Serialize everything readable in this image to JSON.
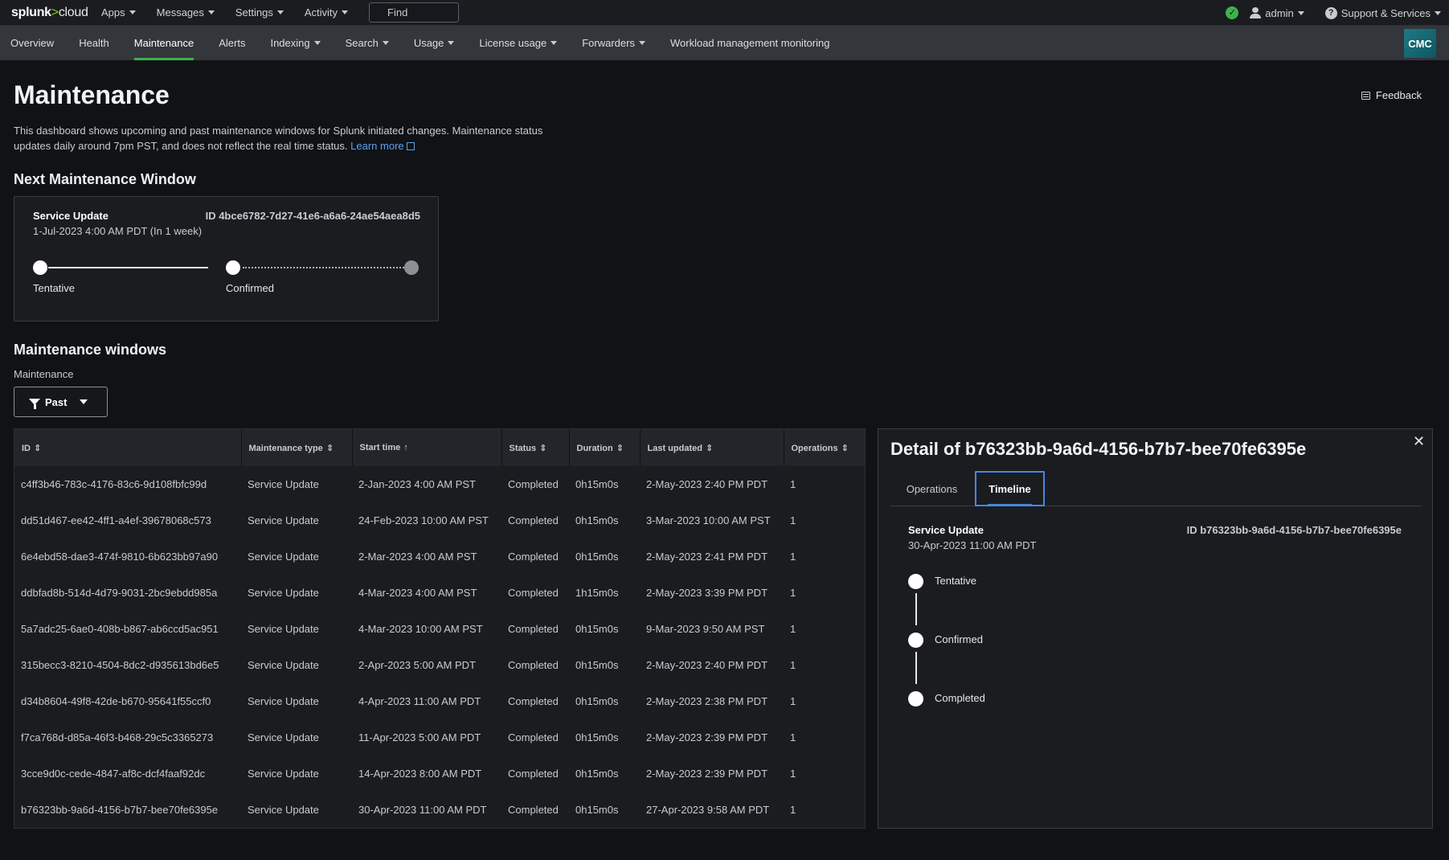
{
  "topbar": {
    "logo_main": "splunk",
    "logo_gt": ">",
    "logo_suffix": "cloud",
    "menu": [
      "Apps",
      "Messages",
      "Settings",
      "Activity"
    ],
    "find_label": "Find",
    "user": "admin",
    "support": "Support & Services"
  },
  "nav": {
    "tabs": [
      {
        "label": "Overview",
        "dropdown": false
      },
      {
        "label": "Health",
        "dropdown": false
      },
      {
        "label": "Maintenance",
        "dropdown": false,
        "active": true
      },
      {
        "label": "Alerts",
        "dropdown": false
      },
      {
        "label": "Indexing",
        "dropdown": true
      },
      {
        "label": "Search",
        "dropdown": true
      },
      {
        "label": "Usage",
        "dropdown": true
      },
      {
        "label": "License usage",
        "dropdown": true
      },
      {
        "label": "Forwarders",
        "dropdown": true
      },
      {
        "label": "Workload management monitoring",
        "dropdown": false
      }
    ],
    "app_badge": "CMC"
  },
  "page": {
    "title": "Maintenance",
    "feedback": "Feedback",
    "description": "This dashboard shows upcoming and past maintenance windows for Splunk initiated changes. Maintenance status updates daily around 7pm PST, and does not reflect the real time status.",
    "learn_more": "Learn more"
  },
  "next_window": {
    "heading": "Next Maintenance Window",
    "type": "Service Update",
    "date": "1-Jul-2023 4:00 AM PDT (In 1 week)",
    "id": "ID 4bce6782-7d27-41e6-a6a6-24ae54aea8d5",
    "steps": [
      "Tentative",
      "Confirmed"
    ]
  },
  "windows": {
    "heading": "Maintenance windows",
    "filter_label": "Maintenance",
    "filter_value": "Past",
    "columns": [
      "ID",
      "Maintenance type",
      "Start time",
      "Status",
      "Duration",
      "Last updated",
      "Operations"
    ],
    "rows": [
      [
        "c4ff3b46-783c-4176-83c6-9d108fbfc99d",
        "Service Update",
        "2-Jan-2023 4:00 AM PST",
        "Completed",
        "0h15m0s",
        "2-May-2023 2:40 PM PDT",
        "1"
      ],
      [
        "dd51d467-ee42-4ff1-a4ef-39678068c573",
        "Service Update",
        "24-Feb-2023 10:00 AM PST",
        "Completed",
        "0h15m0s",
        "3-Mar-2023 10:00 AM PST",
        "1"
      ],
      [
        "6e4ebd58-dae3-474f-9810-6b623bb97a90",
        "Service Update",
        "2-Mar-2023 4:00 AM PST",
        "Completed",
        "0h15m0s",
        "2-May-2023 2:41 PM PDT",
        "1"
      ],
      [
        "ddbfad8b-514d-4d79-9031-2bc9ebdd985a",
        "Service Update",
        "4-Mar-2023 4:00 AM PST",
        "Completed",
        "1h15m0s",
        "2-May-2023 3:39 PM PDT",
        "1"
      ],
      [
        "5a7adc25-6ae0-408b-b867-ab6ccd5ac951",
        "Service Update",
        "4-Mar-2023 10:00 AM PST",
        "Completed",
        "0h15m0s",
        "9-Mar-2023 9:50 AM PST",
        "1"
      ],
      [
        "315becc3-8210-4504-8dc2-d935613bd6e5",
        "Service Update",
        "2-Apr-2023 5:00 AM PDT",
        "Completed",
        "0h15m0s",
        "2-May-2023 2:40 PM PDT",
        "1"
      ],
      [
        "d34b8604-49f8-42de-b670-95641f55ccf0",
        "Service Update",
        "4-Apr-2023 11:00 AM PDT",
        "Completed",
        "0h15m0s",
        "2-May-2023 2:38 PM PDT",
        "1"
      ],
      [
        "f7ca768d-d85a-46f3-b468-29c5c3365273",
        "Service Update",
        "11-Apr-2023 5:00 AM PDT",
        "Completed",
        "0h15m0s",
        "2-May-2023 2:39 PM PDT",
        "1"
      ],
      [
        "3cce9d0c-cede-4847-af8c-dcf4faaf92dc",
        "Service Update",
        "14-Apr-2023 8:00 AM PDT",
        "Completed",
        "0h15m0s",
        "2-May-2023 2:39 PM PDT",
        "1"
      ],
      [
        "b76323bb-9a6d-4156-b7b7-bee70fe6395e",
        "Service Update",
        "30-Apr-2023 11:00 AM PDT",
        "Completed",
        "0h15m0s",
        "27-Apr-2023 9:58 AM PDT",
        "1"
      ]
    ]
  },
  "detail": {
    "title": "Detail of b76323bb-9a6d-4156-b7b7-bee70fe6395e",
    "tabs": [
      "Operations",
      "Timeline"
    ],
    "active_tab": "Timeline",
    "type": "Service Update",
    "date": "30-Apr-2023 11:00 AM PDT",
    "id": "ID b76323bb-9a6d-4156-b7b7-bee70fe6395e",
    "timeline": [
      "Tentative",
      "Confirmed",
      "Completed"
    ]
  },
  "colors": {
    "accent_green": "#3cb34a",
    "link_blue": "#5aa3f0",
    "tab_focus": "#4a86e0"
  },
  "icons": {
    "status": "check-circle-icon",
    "user": "user-icon",
    "help": "help-circle-icon",
    "feedback": "message-icon",
    "filter": "funnel-icon",
    "close": "close-icon",
    "external": "external-link-icon"
  }
}
